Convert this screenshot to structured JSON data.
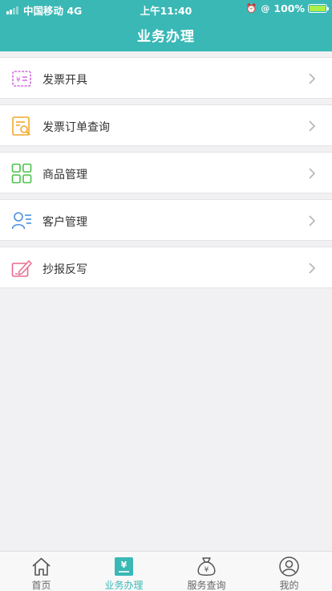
{
  "status_bar": {
    "carrier": "中国移动 4G",
    "time": "上午11:40",
    "battery": "100%"
  },
  "header": {
    "title": "业务办理"
  },
  "menu": [
    {
      "label": "发票开具",
      "icon": "invoice-issue-icon",
      "color": "#d06be0"
    },
    {
      "label": "发票订单查询",
      "icon": "invoice-search-icon",
      "color": "#f0a92e"
    },
    {
      "label": "商品管理",
      "icon": "grid-icon",
      "color": "#4bc24b"
    },
    {
      "label": "客户管理",
      "icon": "customer-icon",
      "color": "#4a90e2"
    },
    {
      "label": "抄报反写",
      "icon": "write-back-icon",
      "color": "#ea6b8f"
    }
  ],
  "tabbar": [
    {
      "label": "首页",
      "icon": "home-icon",
      "active": false
    },
    {
      "label": "业务办理",
      "icon": "yuan-doc-icon",
      "active": true
    },
    {
      "label": "服务查询",
      "icon": "money-bag-icon",
      "active": false
    },
    {
      "label": "我的",
      "icon": "profile-icon",
      "active": false
    }
  ],
  "colors": {
    "accent": "#3ab8b6",
    "background": "#f1f1f4"
  }
}
